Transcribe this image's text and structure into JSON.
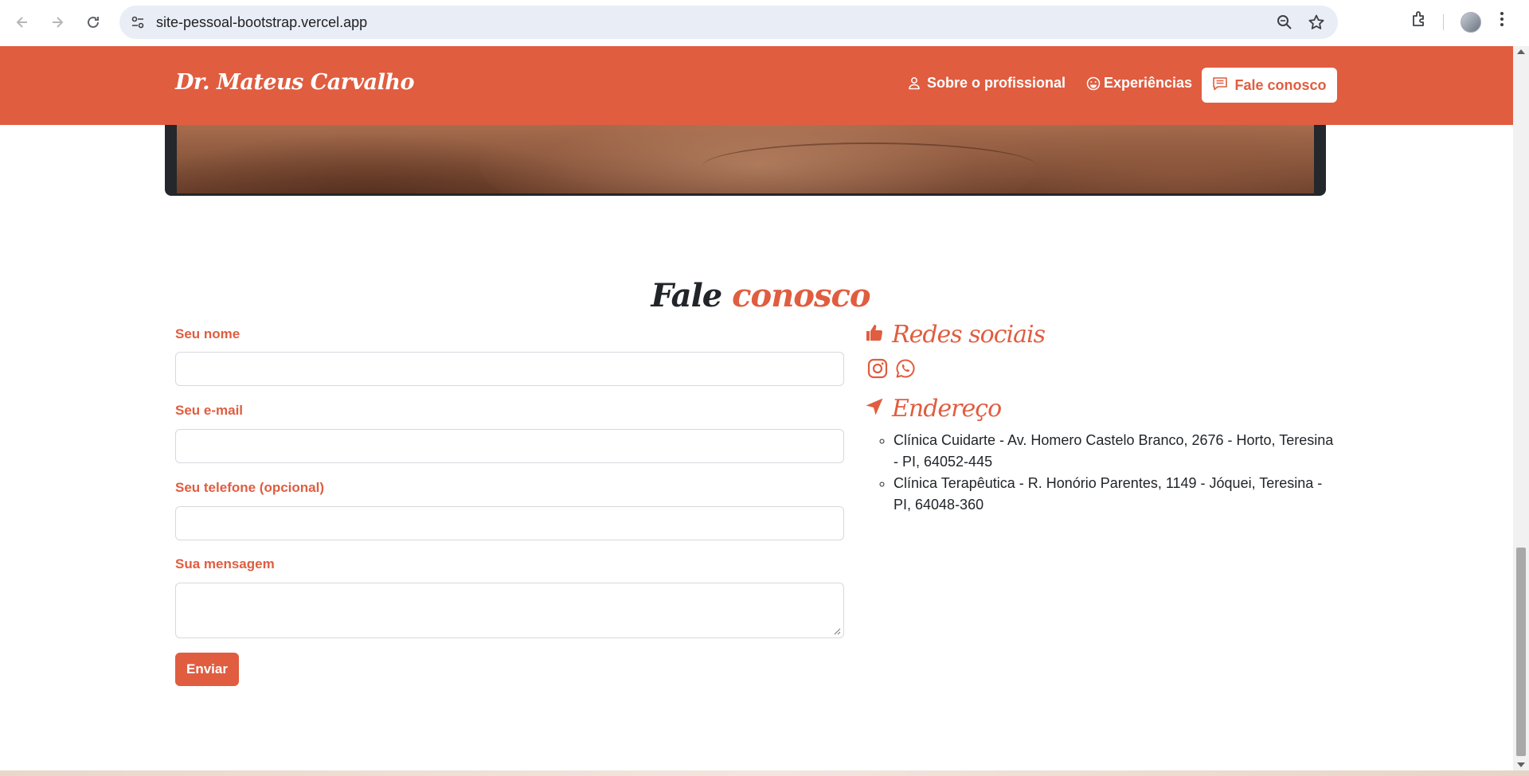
{
  "browser": {
    "url": "site-pessoal-bootstrap.vercel.app",
    "icons": [
      "back-icon",
      "forward-icon",
      "reload-icon",
      "site-settings-icon",
      "zoom-icon",
      "star-icon",
      "extensions-icon",
      "profile-avatar",
      "menu-icon"
    ]
  },
  "navbar": {
    "brand": "Dr. Mateus Carvalho",
    "links": [
      {
        "label": "Sobre o profissional",
        "icon": "person-icon"
      },
      {
        "label": "Experiências",
        "icon": "smile-icon"
      },
      {
        "label": "Fale conosco",
        "icon": "chat-icon"
      }
    ],
    "colors": {
      "primary": "#e05d40",
      "text": "#ffffff"
    }
  },
  "contact": {
    "title_dark": "Fale",
    "title_accent": "conosco",
    "form": {
      "name_label": "Seu nome",
      "name_value": "",
      "email_label": "Seu e-mail",
      "email_value": "",
      "phone_label": "Seu telefone (opcional)",
      "phone_value": "",
      "message_label": "Sua mensagem",
      "message_value": "",
      "submit_label": "Enviar"
    },
    "social": {
      "heading": "Redes sociais",
      "heading_icon": "thumbs-up-icon",
      "items": [
        "instagram-icon",
        "whatsapp-icon"
      ]
    },
    "address": {
      "heading": "Endereço",
      "heading_icon": "navigation-arrow-icon",
      "items": [
        "Clínica Cuidarte - Av. Homero Castelo Branco, 2676 - Horto, Teresina - PI, 64052-445",
        "Clínica Terapêutica - R. Honório Parentes, 1149 - Jóquei, Teresina - PI, 64048-360"
      ]
    }
  }
}
